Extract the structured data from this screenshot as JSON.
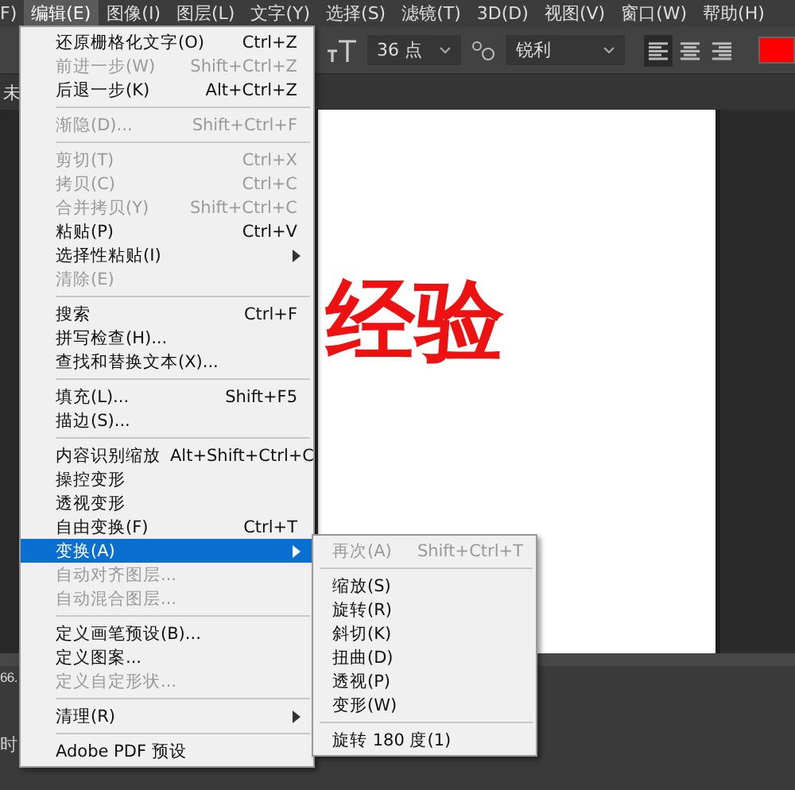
{
  "menu_bar": [
    {
      "label": "F)",
      "selected": false
    },
    {
      "label": "编辑(E)",
      "selected": true
    },
    {
      "label": "图像(I)",
      "selected": false
    },
    {
      "label": "图层(L)",
      "selected": false
    },
    {
      "label": "文字(Y)",
      "selected": false
    },
    {
      "label": "选择(S)",
      "selected": false
    },
    {
      "label": "滤镜(T)",
      "selected": false
    },
    {
      "label": "3D(D)",
      "selected": false
    },
    {
      "label": "视图(V)",
      "selected": false
    },
    {
      "label": "窗口(W)",
      "selected": false
    },
    {
      "label": "帮助(H)",
      "selected": false
    }
  ],
  "options_bar": {
    "font_size": "36 点",
    "antialias": "锐利",
    "align": [
      {
        "selected": true
      },
      {
        "selected": false
      },
      {
        "selected": false
      }
    ]
  },
  "document_tab": "未",
  "canvas_text": "经验",
  "bottom_panel": [
    "66.",
    "时"
  ],
  "edit_menu": [
    {
      "kind": "item",
      "label": "还原栅格化文字(O)",
      "shortcut": "Ctrl+Z",
      "disabled": false,
      "selected": false,
      "submenu": false
    },
    {
      "kind": "item",
      "label": "前进一步(W)",
      "shortcut": "Shift+Ctrl+Z",
      "disabled": true,
      "selected": false,
      "submenu": false
    },
    {
      "kind": "item",
      "label": "后退一步(K)",
      "shortcut": "Alt+Ctrl+Z",
      "disabled": false,
      "selected": false,
      "submenu": false
    },
    {
      "kind": "separator"
    },
    {
      "kind": "item",
      "label": "渐隐(D)...",
      "shortcut": "Shift+Ctrl+F",
      "disabled": true,
      "selected": false,
      "submenu": false
    },
    {
      "kind": "separator"
    },
    {
      "kind": "item",
      "label": "剪切(T)",
      "shortcut": "Ctrl+X",
      "disabled": true,
      "selected": false,
      "submenu": false
    },
    {
      "kind": "item",
      "label": "拷贝(C)",
      "shortcut": "Ctrl+C",
      "disabled": true,
      "selected": false,
      "submenu": false
    },
    {
      "kind": "item",
      "label": "合并拷贝(Y)",
      "shortcut": "Shift+Ctrl+C",
      "disabled": true,
      "selected": false,
      "submenu": false
    },
    {
      "kind": "item",
      "label": "粘贴(P)",
      "shortcut": "Ctrl+V",
      "disabled": false,
      "selected": false,
      "submenu": false
    },
    {
      "kind": "item",
      "label": "选择性粘贴(I)",
      "disabled": false,
      "selected": false,
      "submenu": true
    },
    {
      "kind": "item",
      "label": "清除(E)",
      "disabled": true,
      "selected": false,
      "submenu": false
    },
    {
      "kind": "separator"
    },
    {
      "kind": "item",
      "label": "搜索",
      "shortcut": "Ctrl+F",
      "disabled": false,
      "selected": false,
      "submenu": false
    },
    {
      "kind": "item",
      "label": "拼写检查(H)...",
      "disabled": false,
      "selected": false,
      "submenu": false
    },
    {
      "kind": "item",
      "label": "查找和替换文本(X)...",
      "disabled": false,
      "selected": false,
      "submenu": false
    },
    {
      "kind": "separator"
    },
    {
      "kind": "item",
      "label": "填充(L)...",
      "shortcut": "Shift+F5",
      "disabled": false,
      "selected": false,
      "submenu": false
    },
    {
      "kind": "item",
      "label": "描边(S)...",
      "disabled": false,
      "selected": false,
      "submenu": false
    },
    {
      "kind": "separator"
    },
    {
      "kind": "item",
      "label": "内容识别缩放",
      "shortcut": "Alt+Shift+Ctrl+C",
      "disabled": false,
      "selected": false,
      "submenu": false
    },
    {
      "kind": "item",
      "label": "操控变形",
      "disabled": false,
      "selected": false,
      "submenu": false
    },
    {
      "kind": "item",
      "label": "透视变形",
      "disabled": false,
      "selected": false,
      "submenu": false
    },
    {
      "kind": "item",
      "label": "自由变换(F)",
      "shortcut": "Ctrl+T",
      "disabled": false,
      "selected": false,
      "submenu": false
    },
    {
      "kind": "item",
      "label": "变换(A)",
      "disabled": false,
      "selected": true,
      "submenu": true
    },
    {
      "kind": "item",
      "label": "自动对齐图层...",
      "disabled": true,
      "selected": false,
      "submenu": false
    },
    {
      "kind": "item",
      "label": "自动混合图层...",
      "disabled": true,
      "selected": false,
      "submenu": false
    },
    {
      "kind": "separator"
    },
    {
      "kind": "item",
      "label": "定义画笔预设(B)...",
      "disabled": false,
      "selected": false,
      "submenu": false
    },
    {
      "kind": "item",
      "label": "定义图案...",
      "disabled": false,
      "selected": false,
      "submenu": false
    },
    {
      "kind": "item",
      "label": "定义自定形状...",
      "disabled": true,
      "selected": false,
      "submenu": false
    },
    {
      "kind": "separator"
    },
    {
      "kind": "item",
      "label": "清理(R)",
      "disabled": false,
      "selected": false,
      "submenu": true
    },
    {
      "kind": "separator"
    },
    {
      "kind": "item",
      "label": "Adobe PDF 预设",
      "disabled": false,
      "selected": false,
      "submenu": false
    }
  ],
  "transform_submenu": [
    {
      "kind": "item",
      "label": "再次(A)",
      "shortcut": "Shift+Ctrl+T",
      "disabled": true
    },
    {
      "kind": "separator"
    },
    {
      "kind": "item",
      "label": "缩放(S)",
      "disabled": false
    },
    {
      "kind": "item",
      "label": "旋转(R)",
      "disabled": false
    },
    {
      "kind": "item",
      "label": "斜切(K)",
      "disabled": false
    },
    {
      "kind": "item",
      "label": "扭曲(D)",
      "disabled": false
    },
    {
      "kind": "item",
      "label": "透视(P)",
      "disabled": false
    },
    {
      "kind": "item",
      "label": "变形(W)",
      "disabled": false
    },
    {
      "kind": "separator"
    },
    {
      "kind": "item",
      "label": "旋转 180 度(1)",
      "disabled": false
    }
  ]
}
